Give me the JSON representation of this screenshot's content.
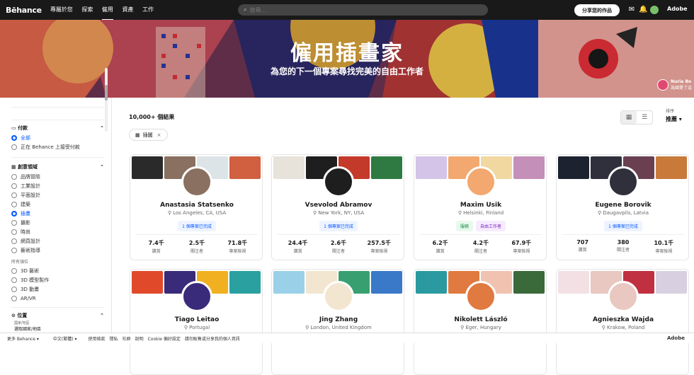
{
  "topbar": {
    "logo": "Bēhance",
    "nav": [
      "專屬於您",
      "探索",
      "僱用",
      "資產",
      "工作"
    ],
    "active_nav": "僱用",
    "search_placeholder": "搜尋…",
    "share_button": "分享您的作品",
    "icons": [
      "mail-icon",
      "bell-icon",
      "avatar"
    ],
    "adobe_label": "Adobe"
  },
  "hero": {
    "title": "僱用插畫家",
    "subtitle": "為您的下一個專案尋找完美的自由工作者",
    "credit_name": "Nuria Bo",
    "credit_sub": "為國愛了這"
  },
  "sidebar": {
    "payment": {
      "title": "付款",
      "options": [
        {
          "label": "全部",
          "selected": true
        },
        {
          "label": "正在 Behance 上接受付款",
          "selected": false
        }
      ]
    },
    "creative": {
      "title": "創意領域",
      "options": [
        {
          "label": "品牌冒險",
          "selected": false
        },
        {
          "label": "工業設計",
          "selected": false
        },
        {
          "label": "平面設計",
          "selected": false
        },
        {
          "label": "建築",
          "selected": false
        },
        {
          "label": "插畫",
          "selected": true
        },
        {
          "label": "攝影",
          "selected": false
        },
        {
          "label": "時尚",
          "selected": false
        },
        {
          "label": "網頁設計",
          "selected": false
        },
        {
          "label": "藝術指導",
          "selected": false
        }
      ],
      "subhead": "所有領位",
      "more": [
        {
          "label": "3D 藝術",
          "selected": false
        },
        {
          "label": "3D 模型製作",
          "selected": false
        },
        {
          "label": "3D 動畫",
          "selected": false
        },
        {
          "label": "AR/VR",
          "selected": false
        }
      ]
    },
    "location": {
      "title": "位置",
      "sub": "國家/地區",
      "value": "選取國家/地區"
    }
  },
  "main": {
    "results": "10,000+ 個結果",
    "chip": "插圖",
    "sort_label": "排序",
    "sort_value": "推薦"
  },
  "cards": [
    {
      "name": "Anastasia Statsenko",
      "loc": "Los Angeles, CA, USA",
      "badges": [
        "1 個專案已完成"
      ],
      "stats": [
        [
          "7.4千",
          "讚賞"
        ],
        [
          "2.5千",
          "關注者"
        ],
        [
          "71.8千",
          "專案檢視"
        ]
      ],
      "colors": [
        "#2a2a2a",
        "#8a7060",
        "#dde4e8",
        "#d06040"
      ]
    },
    {
      "name": "Vsevolod Abramov",
      "loc": "New York, NY, USA",
      "badges": [
        "1 個專案已完成"
      ],
      "stats": [
        [
          "24.4千",
          "讚賞"
        ],
        [
          "2.6千",
          "關注者"
        ],
        [
          "257.5千",
          "專案檢視"
        ]
      ],
      "colors": [
        "#e7e2da",
        "#1e1e1e",
        "#c43a2a",
        "#2e7a42"
      ]
    },
    {
      "name": "Maxim Usik",
      "loc": "Helsinki, Finland",
      "badges": [
        "服務",
        "自由工作者"
      ],
      "stats": [
        [
          "6.2千",
          "讚賞"
        ],
        [
          "4.2千",
          "關注者"
        ],
        [
          "67.9千",
          "專案檢視"
        ]
      ],
      "colors": [
        "#d4c4e8",
        "#f2a86e",
        "#f0d8a0",
        "#c48fb8"
      ]
    },
    {
      "name": "Eugene Borovik",
      "loc": "Daugavpils, Latvia",
      "badges": [
        "1 個專案已完成"
      ],
      "stats": [
        [
          "707",
          "讚賞"
        ],
        [
          "380",
          "關注者"
        ],
        [
          "10.1千",
          "專案檢視"
        ]
      ],
      "colors": [
        "#1c2230",
        "#30303c",
        "#6a4050",
        "#c87a3a"
      ]
    },
    {
      "name": "Tiago Leitao",
      "loc": "Portugal",
      "badges": [],
      "stats": [],
      "colors": [
        "#e04a2a",
        "#3a2a7a",
        "#f0b020",
        "#2aa0a0"
      ]
    },
    {
      "name": "Jing Zhang",
      "loc": "London, United Kingdom",
      "badges": [],
      "stats": [],
      "colors": [
        "#9ad0e8",
        "#f3e6d0",
        "#38a070",
        "#3a78c8"
      ]
    },
    {
      "name": "Nikolett László",
      "loc": "Eger, Hungary",
      "badges": [],
      "stats": [],
      "colors": [
        "#2a9aa0",
        "#e07a40",
        "#f2c2b0",
        "#3a6a3a"
      ]
    },
    {
      "name": "Agnieszka Wajda",
      "loc": "Krakow, Poland",
      "badges": [],
      "stats": [],
      "colors": [
        "#f2e0e4",
        "#e8c8c0",
        "#c03040",
        "#d8d0e0"
      ]
    }
  ],
  "footer": {
    "items": [
      "更多 Behance ▾",
      "中文(繁體) ▾",
      "使用條款",
      "隱私",
      "社群",
      "說明",
      "Cookie 偏好設定",
      "請勿販售或分享我的個人資訊"
    ],
    "adobe": "Adobe"
  }
}
